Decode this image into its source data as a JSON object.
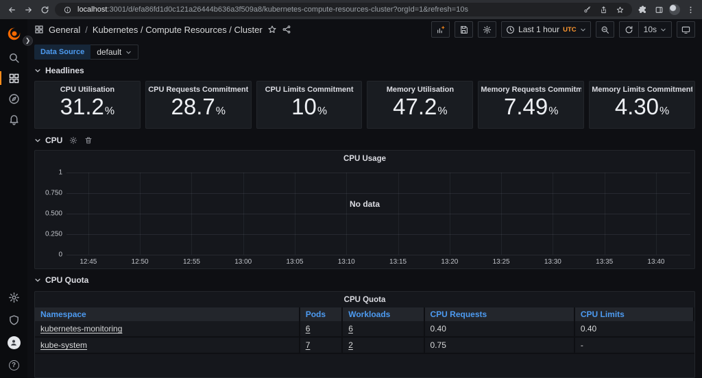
{
  "browser": {
    "url_host": "localhost",
    "url_rest": ":3001/d/efa86fd1d0c121a26444b636a3f509a8/kubernetes-compute-resources-cluster?orgId=1&refresh=10s"
  },
  "header": {
    "breadcrumb_root": "General",
    "breadcrumb_sep": "/",
    "breadcrumb_path": "Kubernetes / Compute Resources / Cluster",
    "time_range": "Last 1 hour",
    "timezone": "UTC",
    "refresh_interval": "10s"
  },
  "submenu": {
    "label": "Data Source",
    "value": "default"
  },
  "sections": {
    "headlines": "Headlines",
    "cpu": "CPU",
    "cpu_quota": "CPU Quota"
  },
  "stats": [
    {
      "title": "CPU Utilisation",
      "value": "31.2",
      "unit": "%"
    },
    {
      "title": "CPU Requests Commitment",
      "value": "28.7",
      "unit": "%"
    },
    {
      "title": "CPU Limits Commitment",
      "value": "10",
      "unit": "%"
    },
    {
      "title": "Memory Utilisation",
      "value": "47.2",
      "unit": "%"
    },
    {
      "title": "Memory Requests Commitm...",
      "value": "7.49",
      "unit": "%"
    },
    {
      "title": "Memory Limits Commitment",
      "value": "4.30",
      "unit": "%"
    }
  ],
  "chart_data": {
    "type": "line",
    "title": "CPU Usage",
    "no_data": "No data",
    "series": [],
    "x_ticks": [
      "12:45",
      "12:50",
      "12:55",
      "13:00",
      "13:05",
      "13:10",
      "13:15",
      "13:20",
      "13:25",
      "13:30",
      "13:35",
      "13:40"
    ],
    "y_ticks": [
      "1",
      "0.750",
      "0.500",
      "0.250",
      "0"
    ],
    "ylim": [
      0,
      1
    ],
    "grid": true,
    "legend": "none"
  },
  "table": {
    "title": "CPU Quota",
    "columns": [
      "Namespace",
      "Pods",
      "Workloads",
      "CPU Requests",
      "CPU Limits"
    ],
    "rows": [
      [
        "kubernetes-monitoring",
        "6",
        "6",
        "0.40",
        "0.40"
      ],
      [
        "kube-system",
        "7",
        "2",
        "0.75",
        "-"
      ]
    ]
  },
  "colors": {
    "accent_orange": "#ff8c1a",
    "logo_orange": "#f46800",
    "link_blue": "#4d9bf1",
    "panel_bg": "#191c21",
    "page_bg": "#0e0f13"
  }
}
